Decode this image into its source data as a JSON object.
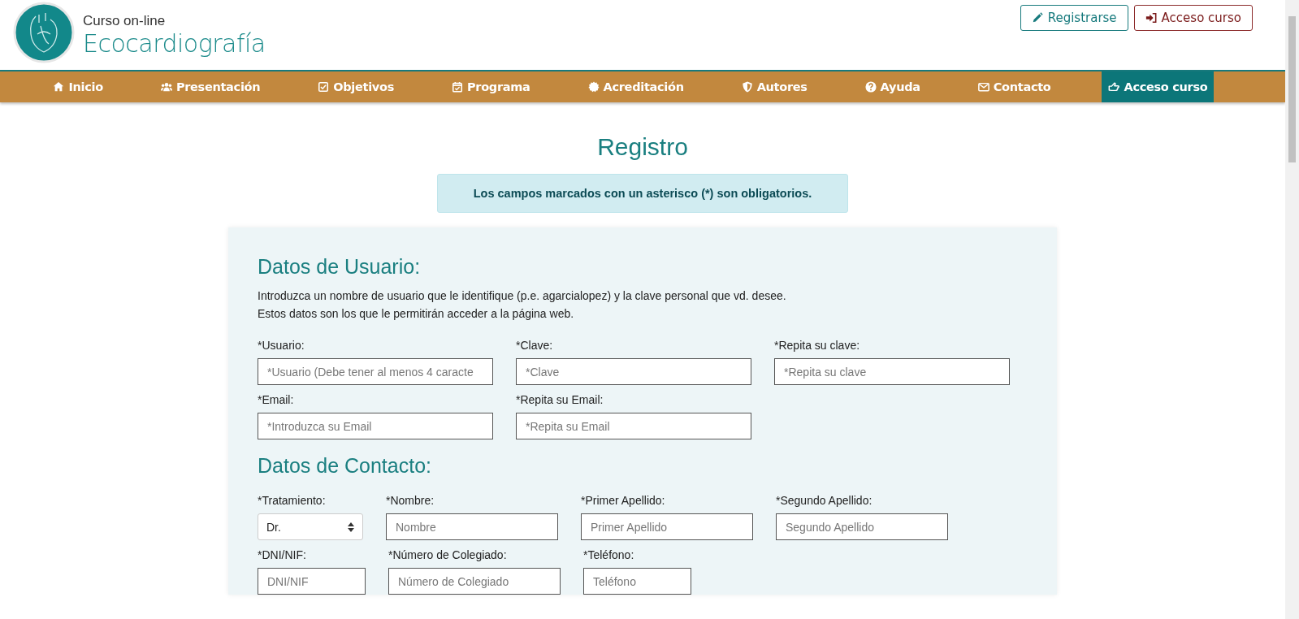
{
  "header": {
    "subtitle": "Curso  on-line",
    "title": "Ecocardiografía",
    "buttons": [
      {
        "label": "Registrarse",
        "kind": "register"
      },
      {
        "label": "Acceso curso",
        "kind": "login"
      }
    ]
  },
  "nav": [
    {
      "label": "Inicio",
      "selected": false
    },
    {
      "label": "Presentación",
      "selected": false
    },
    {
      "label": "Objetivos",
      "selected": false
    },
    {
      "label": "Programa",
      "selected": false
    },
    {
      "label": "Acreditación",
      "selected": false
    },
    {
      "label": "Autores",
      "selected": false
    },
    {
      "label": "Ayuda",
      "selected": false
    },
    {
      "label": "Contacto",
      "selected": false
    },
    {
      "label": "Acceso curso",
      "selected": true
    }
  ],
  "page_title": "Registro",
  "notice": "Los campos marcados con un asterisco (*) son obligatorios.",
  "sections": [
    {
      "heading": "Datos de Usuario:",
      "intro": [
        "Introduzca un nombre de usuario que le identifique (p.e. agarcialopez) y la clave personal que vd. desee.",
        "Estos datos son los que le permitirán acceder a la página web."
      ],
      "rows": [
        [
          {
            "label": "*Usuario:",
            "kind": "input",
            "placeholder": "*Usuario (Debe tener al menos 4 caracte"
          },
          {
            "label": "*Clave:",
            "kind": "input",
            "placeholder": "*Clave"
          },
          {
            "label": "*Repita su clave:",
            "kind": "input",
            "placeholder": "*Repita su clave"
          }
        ],
        [
          {
            "label": "*Email:",
            "kind": "input",
            "placeholder": "*Introduzca su Email"
          },
          {
            "label": "*Repita su Email:",
            "kind": "input",
            "placeholder": "*Repita su Email"
          }
        ]
      ]
    },
    {
      "heading": "Datos de Contacto:",
      "rows": [
        [
          {
            "label": "*Tratamiento:",
            "kind": "select",
            "value": "Dr."
          },
          {
            "label": "*Nombre:",
            "kind": "input",
            "placeholder": "Nombre"
          },
          {
            "label": "*Primer Apellido:",
            "kind": "input",
            "placeholder": "Primer Apellido"
          },
          {
            "label": "*Segundo Apellido:",
            "kind": "input",
            "placeholder": "Segundo Apellido"
          }
        ],
        [
          {
            "label": "*DNI/NIF:",
            "kind": "input",
            "placeholder": "DNI/NIF"
          },
          {
            "label": "*Número de Colegiado:",
            "kind": "input",
            "placeholder": "Número de Colegiado"
          },
          {
            "label": "*Teléfono:",
            "kind": "input",
            "placeholder": "Teléfono"
          }
        ]
      ]
    }
  ]
}
